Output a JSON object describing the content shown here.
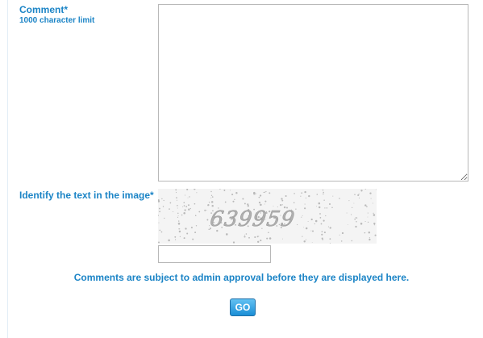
{
  "form": {
    "comment_label": "Comment*",
    "comment_limit": "1000 character limit",
    "comment_value": "",
    "captcha_label": "Identify the text in the image*",
    "captcha_text": "639959",
    "captcha_input_value": "",
    "notice": "Comments are subject to admin approval before they are displayed here.",
    "submit_label": "GO"
  },
  "colors": {
    "label": "#1b84c6",
    "button_top": "#63c1f2",
    "button_bottom": "#1b8ed6",
    "border": "#b8b8b8"
  }
}
